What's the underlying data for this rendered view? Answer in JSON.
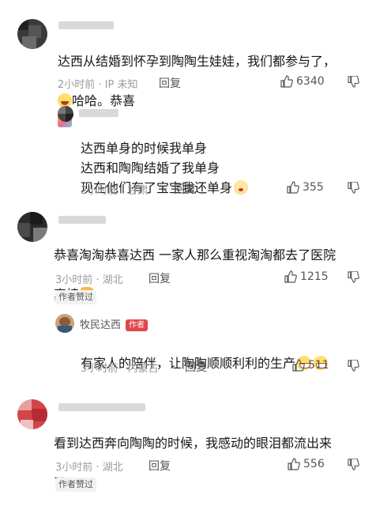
{
  "comments": [
    {
      "text": "达西从结婚到怀孕到陶陶生娃娃，我们都参与了，",
      "text2": "哈哈。恭喜",
      "time": "2小时前 · IP 未知",
      "reply": "回复",
      "likes": "6340"
    },
    {
      "text": "达西单身的时候我单身\n达西和陶陶结婚了我单身\n现在他们有了宝宝我还单身",
      "time": "2小时前 · 甘肃",
      "reply": "回复",
      "likes": "355"
    },
    {
      "text": "恭喜淘淘恭喜达西 一家人那么重视淘淘都去了医院",
      "text2": "真棒",
      "time": "3小时前 · 湖北",
      "reply": "回复",
      "likes": "1215",
      "author_liked": "作者赞过"
    },
    {
      "username": "牧民达西",
      "badge": "作者",
      "text": "有家人的陪伴，让陶陶顺顺利利的生产",
      "time": "3小时前 · 内蒙古",
      "reply": "回复",
      "likes": "511"
    },
    {
      "text": "看到达西奔向陶陶的时候，我感动的眼泪都流出来",
      "text2": "了",
      "time": "3小时前 · 湖北",
      "reply": "回复",
      "likes": "556",
      "author_liked": "作者赞过"
    }
  ]
}
